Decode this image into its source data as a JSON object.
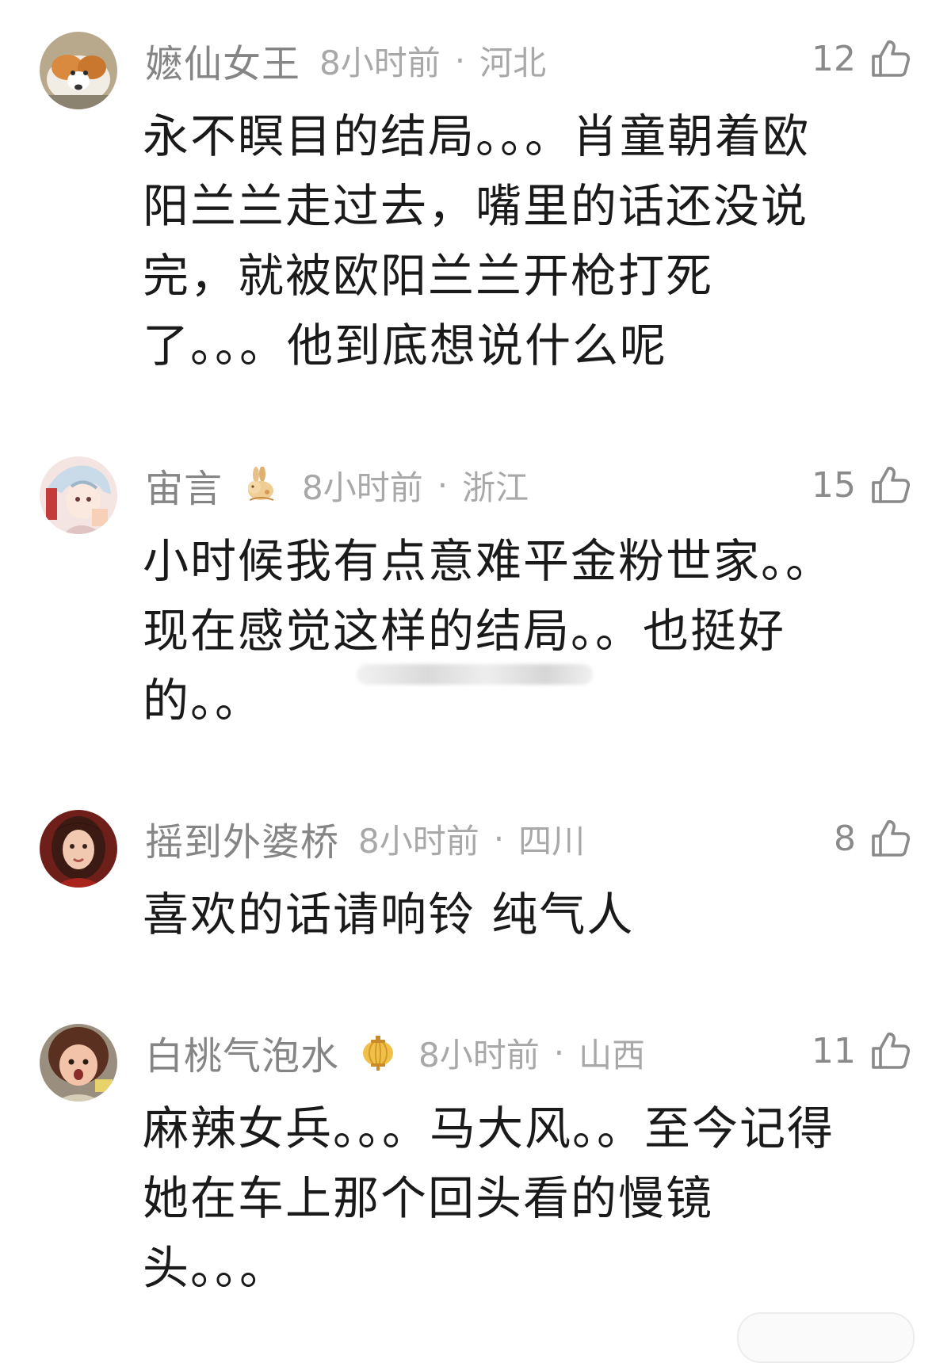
{
  "comments": [
    {
      "username": "嬷仙女王",
      "time": "8小时前",
      "separator": "·",
      "location": "河北",
      "likes": "12",
      "avatar_icon": "corgi-dog-avatar",
      "badge_icon": null,
      "text": "永不瞑目的结局。。。肖童朝着欧阳兰兰走过去，嘴里的话还没说完，就被欧阳兰兰开枪打死了。。。他到底想说什么呢"
    },
    {
      "username": "宙言",
      "time": "8小时前",
      "separator": "·",
      "location": "浙江",
      "likes": "15",
      "avatar_icon": "anime-character-avatar",
      "badge_icon": "rabbit-badge-icon",
      "text": "小时候我有点意难平金粉世家。。现在感觉这样的结局。。也挺好的。。"
    },
    {
      "username": "摇到外婆桥",
      "time": "8小时前",
      "separator": "·",
      "location": "四川",
      "likes": "8",
      "avatar_icon": "girl-portrait-avatar",
      "badge_icon": null,
      "text": "喜欢的话请响铃 纯气人"
    },
    {
      "username": "白桃气泡水",
      "time": "8小时前",
      "separator": "·",
      "location": "山西",
      "likes": "11",
      "avatar_icon": "child-photo-avatar",
      "badge_icon": "lantern-badge-icon",
      "text": "麻辣女兵。。。马大风。。至今记得她在车上那个回头看的慢镜头。。。"
    }
  ],
  "colors": {
    "username": "#858585",
    "meta": "#a8a8a8",
    "body": "#1a1a1a",
    "like_icon": "#8a8a8a"
  },
  "icons": {
    "like": "thumbs-up-outline-icon"
  }
}
